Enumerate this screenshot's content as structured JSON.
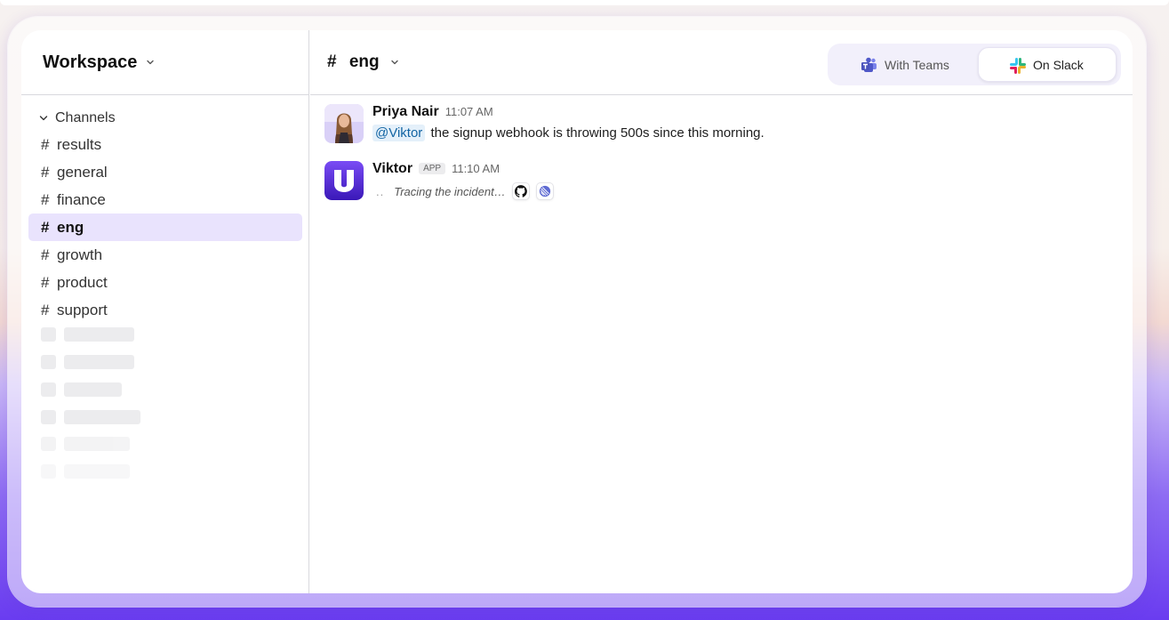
{
  "workspace": {
    "title": "Workspace"
  },
  "sidebar": {
    "section_label": "Channels",
    "channels": [
      {
        "hash": "#",
        "name": "results"
      },
      {
        "hash": "#",
        "name": "general"
      },
      {
        "hash": "#",
        "name": "finance"
      },
      {
        "hash": "#",
        "name": "eng",
        "active": true
      },
      {
        "hash": "#",
        "name": "growth"
      },
      {
        "hash": "#",
        "name": "product"
      },
      {
        "hash": "#",
        "name": "support"
      }
    ]
  },
  "channel_header": {
    "hash": "#",
    "name": "eng"
  },
  "toggle": {
    "teams_label": "With Teams",
    "slack_label": "On Slack",
    "selected": "On Slack"
  },
  "messages": [
    {
      "author": "Priya Nair",
      "time": "11:07 AM",
      "mention": "@Viktor",
      "text": "the signup webhook is throwing 500s since this morning."
    },
    {
      "author": "Viktor",
      "badge": "APP",
      "time": "11:10 AM",
      "dots": "..",
      "status": "Tracing the incident…",
      "tools": [
        "github-icon",
        "linear-icon"
      ]
    }
  ],
  "colors": {
    "accent": "#6a3cf0",
    "active_channel_bg": "#e9e3fd",
    "mention_bg": "#e4f0fa",
    "mention_text": "#1264a3"
  }
}
